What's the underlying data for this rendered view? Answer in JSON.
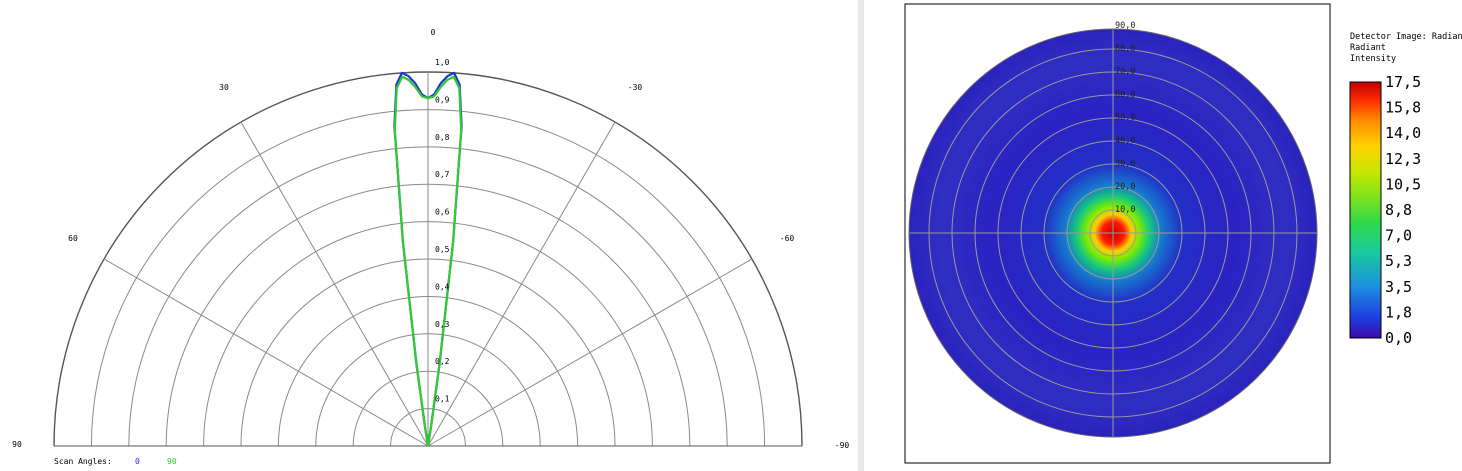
{
  "chart_data": [
    {
      "type": "polar-line",
      "angle_labels": [
        "0",
        "30",
        "-30",
        "60",
        "-60",
        "90",
        "-90"
      ],
      "radial_labels": [
        "1,0",
        "0,9",
        "0,8",
        "0,7",
        "0,6",
        "0,5",
        "0,4",
        "0,3",
        "0,2",
        "0,1"
      ],
      "rlim": [
        0,
        1
      ],
      "angle_range_deg": [
        -90,
        90
      ],
      "grid": true,
      "legend": {
        "title": "Scan Angles:",
        "entries": [
          "0",
          "90"
        ]
      },
      "series": [
        {
          "name": "0",
          "color": "#1f35d8",
          "theta": [
            -10,
            -9,
            -8,
            -7,
            -6,
            -5,
            -4,
            -3,
            -2,
            -1,
            0,
            1,
            2,
            3,
            4,
            5,
            6,
            7,
            8,
            9,
            10
          ],
          "r": [
            0,
            0.05,
            0.22,
            0.55,
            0.86,
            0.97,
            1.0,
            0.99,
            0.97,
            0.94,
            0.93,
            0.94,
            0.97,
            0.99,
            1.0,
            0.97,
            0.86,
            0.55,
            0.22,
            0.05,
            0
          ]
        },
        {
          "name": "90",
          "color": "#2ecc2e",
          "theta": [
            -10,
            -9,
            -8,
            -7,
            -6,
            -5,
            -4,
            -3,
            -2,
            -1,
            0,
            1,
            2,
            3,
            4,
            5,
            6,
            7,
            8,
            9,
            10
          ],
          "r": [
            0,
            0.05,
            0.22,
            0.55,
            0.85,
            0.96,
            0.99,
            0.98,
            0.96,
            0.935,
            0.93,
            0.935,
            0.96,
            0.98,
            0.99,
            0.96,
            0.85,
            0.55,
            0.22,
            0.05,
            0
          ]
        }
      ]
    },
    {
      "type": "heatmap",
      "title": "Detector Image: Radiant Intensity",
      "radial_labels": [
        "10,0",
        "20,0",
        "30,0",
        "40,0",
        "50,0",
        "60,0",
        "70,0",
        "80,0",
        "90,0"
      ],
      "colorbar_labels": [
        "17,5",
        "15,8",
        "14,0",
        "12,3",
        "10,5",
        "8,8",
        "7,0",
        "5,3",
        "3,5",
        "1,8",
        "0,0"
      ],
      "vlim": [
        0,
        17.5
      ],
      "peak_value": 17.5,
      "peak_center": [
        0,
        0
      ],
      "rlim": [
        0,
        90
      ],
      "grid": true
    }
  ]
}
